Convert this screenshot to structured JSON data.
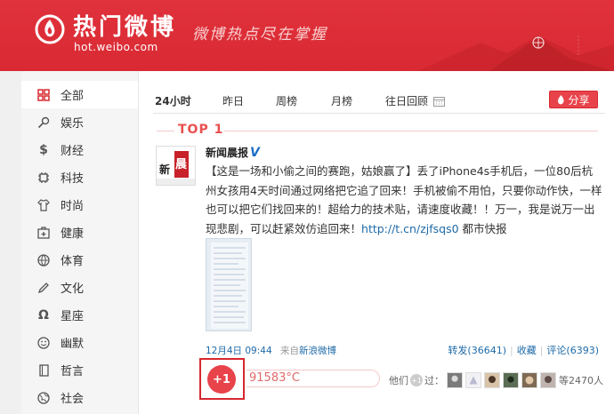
{
  "header": {
    "title": "热门微博",
    "url": "hot.weibo.com",
    "slogan": "微博热点尽在掌握"
  },
  "sidebar": {
    "items": [
      {
        "label": "全部",
        "icon": "grid-icon",
        "active": true
      },
      {
        "label": "娱乐",
        "icon": "microphone-icon"
      },
      {
        "label": "财经",
        "icon": "dollar-icon"
      },
      {
        "label": "科技",
        "icon": "chip-icon"
      },
      {
        "label": "时尚",
        "icon": "shirt-icon"
      },
      {
        "label": "健康",
        "icon": "medkit-icon"
      },
      {
        "label": "体育",
        "icon": "ball-icon"
      },
      {
        "label": "文化",
        "icon": "pen-icon"
      },
      {
        "label": "星座",
        "icon": "omega-icon"
      },
      {
        "label": "幽默",
        "icon": "smiley-icon"
      },
      {
        "label": "哲言",
        "icon": "book-icon"
      },
      {
        "label": "社会",
        "icon": "globe-icon"
      }
    ]
  },
  "tabs": [
    {
      "label": "24小时",
      "active": true
    },
    {
      "label": "昨日"
    },
    {
      "label": "周榜"
    },
    {
      "label": "月榜"
    },
    {
      "label": "往日回顾"
    }
  ],
  "share_label": "分享",
  "post": {
    "rank": "TOP 1",
    "author": "新闻晨报",
    "verified": "V",
    "text_main": "【这是一场和小偷之间的赛跑，姑娘赢了】丢了iPhone4s手机后，一位80后杭州女孩用4天时间通过网络把它追了回来！手机被偷不用怕，只要你动作快，一样也可以把它们找回来的！超给力的技术贴，请速度收藏！！万一，我是说万一出现悲剧，可以赶紧效仿追回来！",
    "link": "http://t.cn/zjfsqs0",
    "source_text": "都市快报",
    "time": "12月4日 09:44",
    "from_label": "来自",
    "client": "新浪微博",
    "repost": "转发(36641)",
    "favorite": "收藏",
    "comment": "评论(6393)",
    "plus_label": "+1",
    "temperature": "91583°C",
    "others_prefix": "他们",
    "others_plus": "+1",
    "others_mid": "过：",
    "others_count": "等2470人"
  },
  "colors": {
    "brand_red": "#d7282f",
    "link_blue": "#1e6aa8"
  }
}
